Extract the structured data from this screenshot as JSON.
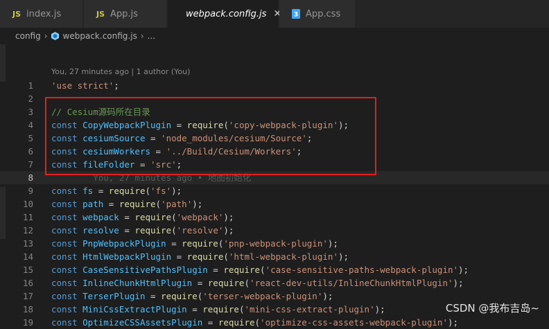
{
  "tabs": [
    {
      "icon": "JS",
      "label": "index.js"
    },
    {
      "icon": "JS",
      "label": "App.js"
    },
    {
      "icon": "webpack",
      "label": "webpack.config.js",
      "close": "✕"
    },
    {
      "icon": "css",
      "label": "App.css"
    }
  ],
  "breadcrumb": {
    "folder": "config",
    "file": "webpack.config.js",
    "more": "..."
  },
  "blame_header": "You, 27 minutes ago | 1 author (You)",
  "blame_inline": "You, 27 minutes ago • 地图初始化",
  "lines": [
    {
      "n": "1",
      "t": [
        {
          "c": "str",
          "v": "'use strict'"
        },
        {
          "c": "pl",
          "v": ";"
        }
      ]
    },
    {
      "n": "2",
      "t": []
    },
    {
      "n": "3",
      "t": [
        {
          "c": "cm",
          "v": "// Cesium源码所在目录"
        }
      ]
    },
    {
      "n": "4",
      "t": [
        {
          "c": "kw",
          "v": "const "
        },
        {
          "c": "cst",
          "v": "CopyWebpackPlugin"
        },
        {
          "c": "pl",
          "v": " = "
        },
        {
          "c": "fn",
          "v": "require"
        },
        {
          "c": "pl",
          "v": "("
        },
        {
          "c": "str",
          "v": "'copy-webpack-plugin'"
        },
        {
          "c": "pl",
          "v": ");"
        }
      ]
    },
    {
      "n": "5",
      "t": [
        {
          "c": "kw",
          "v": "const "
        },
        {
          "c": "cst",
          "v": "cesiumSource"
        },
        {
          "c": "pl",
          "v": " = "
        },
        {
          "c": "str",
          "v": "'node_modules/cesium/Source'"
        },
        {
          "c": "pl",
          "v": ";"
        }
      ]
    },
    {
      "n": "6",
      "t": [
        {
          "c": "kw",
          "v": "const "
        },
        {
          "c": "cst",
          "v": "cesiumWorkers"
        },
        {
          "c": "pl",
          "v": " = "
        },
        {
          "c": "str",
          "v": "'../Build/Cesium/Workers'"
        },
        {
          "c": "pl",
          "v": ";"
        }
      ]
    },
    {
      "n": "7",
      "t": [
        {
          "c": "kw",
          "v": "const "
        },
        {
          "c": "cst",
          "v": "fileFolder"
        },
        {
          "c": "pl",
          "v": " = "
        },
        {
          "c": "str",
          "v": "'src'"
        },
        {
          "c": "pl",
          "v": ";"
        }
      ]
    },
    {
      "n": "8",
      "t": [
        {
          "c": "ghost",
          "v": "        You, 27 minutes ago • 地图初始化"
        }
      ],
      "current": true
    },
    {
      "n": "9",
      "t": [
        {
          "c": "kw",
          "v": "const "
        },
        {
          "c": "cst",
          "v": "fs"
        },
        {
          "c": "pl",
          "v": " = "
        },
        {
          "c": "fn",
          "v": "require"
        },
        {
          "c": "pl",
          "v": "("
        },
        {
          "c": "str",
          "v": "'fs'"
        },
        {
          "c": "pl",
          "v": ");"
        }
      ]
    },
    {
      "n": "10",
      "t": [
        {
          "c": "kw",
          "v": "const "
        },
        {
          "c": "cst",
          "v": "path"
        },
        {
          "c": "pl",
          "v": " = "
        },
        {
          "c": "fn",
          "v": "require"
        },
        {
          "c": "pl",
          "v": "("
        },
        {
          "c": "str",
          "v": "'path'"
        },
        {
          "c": "pl",
          "v": ");"
        }
      ]
    },
    {
      "n": "11",
      "t": [
        {
          "c": "kw",
          "v": "const "
        },
        {
          "c": "cst",
          "v": "webpack"
        },
        {
          "c": "pl",
          "v": " = "
        },
        {
          "c": "fn",
          "v": "require"
        },
        {
          "c": "pl",
          "v": "("
        },
        {
          "c": "str",
          "v": "'webpack'"
        },
        {
          "c": "pl",
          "v": ");"
        }
      ]
    },
    {
      "n": "12",
      "t": [
        {
          "c": "kw",
          "v": "const "
        },
        {
          "c": "cst",
          "v": "resolve"
        },
        {
          "c": "pl",
          "v": " = "
        },
        {
          "c": "fn",
          "v": "require"
        },
        {
          "c": "pl",
          "v": "("
        },
        {
          "c": "str",
          "v": "'resolve'"
        },
        {
          "c": "pl",
          "v": ");"
        }
      ]
    },
    {
      "n": "13",
      "t": [
        {
          "c": "kw",
          "v": "const "
        },
        {
          "c": "cst",
          "v": "PnpWebpackPlugin"
        },
        {
          "c": "pl",
          "v": " = "
        },
        {
          "c": "fn",
          "v": "require"
        },
        {
          "c": "pl",
          "v": "("
        },
        {
          "c": "str",
          "v": "'pnp-webpack-plugin'"
        },
        {
          "c": "pl",
          "v": ");"
        }
      ]
    },
    {
      "n": "14",
      "t": [
        {
          "c": "kw",
          "v": "const "
        },
        {
          "c": "cst",
          "v": "HtmlWebpackPlugin"
        },
        {
          "c": "pl",
          "v": " = "
        },
        {
          "c": "fn",
          "v": "require"
        },
        {
          "c": "pl",
          "v": "("
        },
        {
          "c": "str",
          "v": "'html-webpack-plugin'"
        },
        {
          "c": "pl",
          "v": ");"
        }
      ]
    },
    {
      "n": "15",
      "t": [
        {
          "c": "kw",
          "v": "const "
        },
        {
          "c": "cst",
          "v": "CaseSensitivePathsPlugin"
        },
        {
          "c": "pl",
          "v": " = "
        },
        {
          "c": "fn",
          "v": "require"
        },
        {
          "c": "pl",
          "v": "("
        },
        {
          "c": "str",
          "v": "'case-sensitive-paths-webpack-plugin'"
        },
        {
          "c": "pl",
          "v": ");"
        }
      ]
    },
    {
      "n": "16",
      "t": [
        {
          "c": "kw",
          "v": "const "
        },
        {
          "c": "cst",
          "v": "InlineChunkHtmlPlugin"
        },
        {
          "c": "pl",
          "v": " = "
        },
        {
          "c": "fn",
          "v": "require"
        },
        {
          "c": "pl",
          "v": "("
        },
        {
          "c": "str",
          "v": "'react-dev-utils/InlineChunkHtmlPlugin'"
        },
        {
          "c": "pl",
          "v": ");"
        }
      ]
    },
    {
      "n": "17",
      "t": [
        {
          "c": "kw",
          "v": "const "
        },
        {
          "c": "cst",
          "v": "TerserPlugin"
        },
        {
          "c": "pl",
          "v": " = "
        },
        {
          "c": "fn",
          "v": "require"
        },
        {
          "c": "pl",
          "v": "("
        },
        {
          "c": "str",
          "v": "'terser-webpack-plugin'"
        },
        {
          "c": "pl",
          "v": ");"
        }
      ]
    },
    {
      "n": "18",
      "t": [
        {
          "c": "kw",
          "v": "const "
        },
        {
          "c": "cst",
          "v": "MiniCssExtractPlugin"
        },
        {
          "c": "pl",
          "v": " = "
        },
        {
          "c": "fn",
          "v": "require"
        },
        {
          "c": "pl",
          "v": "("
        },
        {
          "c": "str",
          "v": "'mini-css-extract-plugin'"
        },
        {
          "c": "pl",
          "v": ");"
        }
      ]
    },
    {
      "n": "19",
      "t": [
        {
          "c": "kw",
          "v": "const "
        },
        {
          "c": "cst",
          "v": "OptimizeCSSAssetsPlugin"
        },
        {
          "c": "pl",
          "v": " = "
        },
        {
          "c": "fn",
          "v": "require"
        },
        {
          "c": "pl",
          "v": "("
        },
        {
          "c": "str",
          "v": "'optimize-css-assets-webpack-plugin'"
        },
        {
          "c": "pl",
          "v": ");"
        }
      ]
    }
  ],
  "watermark": "CSDN @我布吉岛~"
}
